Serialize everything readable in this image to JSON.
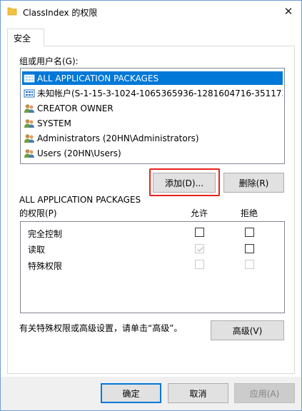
{
  "window": {
    "title": "ClassIndex 的权限",
    "close_glyph": "✕"
  },
  "tabs": [
    {
      "label": "安全"
    }
  ],
  "groups": {
    "label": "组或用户名(G):",
    "items": [
      {
        "name": "ALL APPLICATION PACKAGES",
        "icon": "app-package-icon",
        "selected": true
      },
      {
        "name": "未知帐户(S-1-15-3-1024-1065365936-1281604716-351173...",
        "icon": "app-package-icon",
        "selected": false
      },
      {
        "name": "CREATOR OWNER",
        "icon": "users-icon",
        "selected": false
      },
      {
        "name": "SYSTEM",
        "icon": "users-icon",
        "selected": false
      },
      {
        "name": "Administrators (20HN\\Administrators)",
        "icon": "users-icon",
        "selected": false
      },
      {
        "name": "Users (20HN\\Users)",
        "icon": "users-icon",
        "selected": false
      }
    ]
  },
  "buttons": {
    "add": "添加(D)...",
    "remove": "删除(R)",
    "advanced": "高级(V)",
    "ok": "确定",
    "cancel": "取消",
    "apply": "应用(A)"
  },
  "permissions": {
    "for_line1": "ALL APPLICATION PACKAGES",
    "for_line2": "的权限(P)",
    "allow_header": "允许",
    "deny_header": "拒绝",
    "rows": [
      {
        "name": "完全控制",
        "allow": false,
        "allow_disabled": false,
        "deny": false,
        "deny_disabled": false
      },
      {
        "name": "读取",
        "allow": true,
        "allow_disabled": true,
        "deny": false,
        "deny_disabled": false
      },
      {
        "name": "特殊权限",
        "allow": false,
        "allow_disabled": true,
        "deny": false,
        "deny_disabled": true
      }
    ]
  },
  "advanced_hint": "有关特殊权限或高级设置，请单击“高级”。",
  "colors": {
    "selection": "#0078d7",
    "highlight_box": "#e8221c",
    "folder_icon": "#f4c242"
  }
}
